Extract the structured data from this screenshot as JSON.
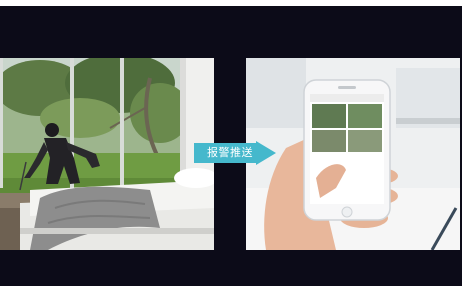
{
  "banner": {
    "arrow_label": "报警推送"
  },
  "colors": {
    "background_band": "#0c0b18",
    "arrow_fill": "#45b8cc",
    "page_background": "#ffffff"
  },
  "icons": {
    "burglar": "burglar-figure-icon",
    "phone": "smartphone-icon",
    "arrow": "push-arrow-icon"
  }
}
